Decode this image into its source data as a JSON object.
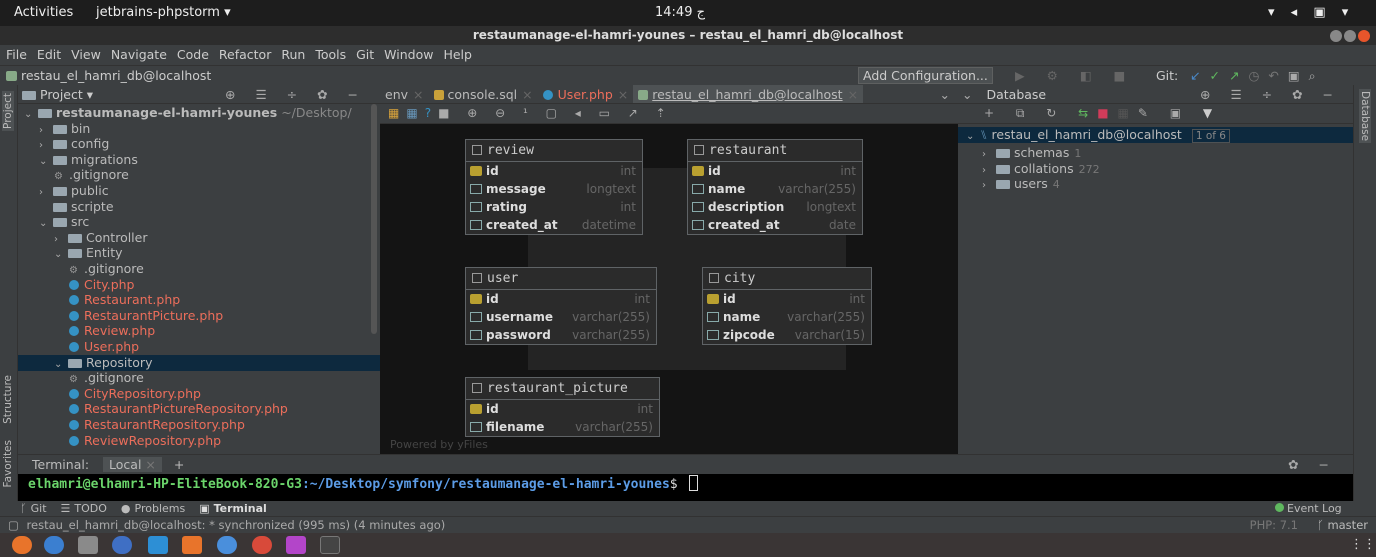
{
  "topbar": {
    "activities": "Activities",
    "app": "jetbrains-phpstorm ▾",
    "clock": "14:49 ج"
  },
  "titlebar": {
    "title": "restaumanage-el-hamri-younes – restau_el_hamri_db@localhost"
  },
  "menu": [
    "File",
    "Edit",
    "View",
    "Navigate",
    "Code",
    "Refactor",
    "Run",
    "Tools",
    "Git",
    "Window",
    "Help"
  ],
  "navbar": {
    "crumb": "restau_el_hamri_db@localhost",
    "add_config": "Add Configuration...",
    "git_label": "Git:"
  },
  "sidebar_left": {
    "project": "Project",
    "structure": "Structure",
    "favorites": "Favorites"
  },
  "sidebar_right": {
    "database": "Database"
  },
  "project_panel": {
    "title": "Project ▾"
  },
  "tree": [
    {
      "label": "restaumanage-el-hamri-younes",
      "suffix": "~/Desktop/",
      "kind": "folder",
      "indent": 0,
      "open": true,
      "bold": true
    },
    {
      "label": "bin",
      "kind": "folder",
      "indent": 1,
      "open": false
    },
    {
      "label": "config",
      "kind": "folder",
      "indent": 1,
      "open": false
    },
    {
      "label": "migrations",
      "kind": "folder",
      "indent": 1,
      "open": true
    },
    {
      "label": ".gitignore",
      "kind": "git",
      "indent": 2
    },
    {
      "label": "public",
      "kind": "folder",
      "indent": 1,
      "open": false
    },
    {
      "label": "scripte",
      "kind": "folder",
      "indent": 1,
      "noarrow": true
    },
    {
      "label": "src",
      "kind": "folder",
      "indent": 1,
      "open": true
    },
    {
      "label": "Controller",
      "kind": "folder",
      "indent": 2,
      "open": false
    },
    {
      "label": "Entity",
      "kind": "folder",
      "indent": 2,
      "open": true
    },
    {
      "label": ".gitignore",
      "kind": "git",
      "indent": 3
    },
    {
      "label": "City.php",
      "kind": "class",
      "indent": 3
    },
    {
      "label": "Restaurant.php",
      "kind": "class",
      "indent": 3
    },
    {
      "label": "RestaurantPicture.php",
      "kind": "class",
      "indent": 3
    },
    {
      "label": "Review.php",
      "kind": "class",
      "indent": 3
    },
    {
      "label": "User.php",
      "kind": "class",
      "indent": 3
    },
    {
      "label": "Repository",
      "kind": "folder",
      "indent": 2,
      "open": true,
      "selected": true
    },
    {
      "label": ".gitignore",
      "kind": "git",
      "indent": 3
    },
    {
      "label": "CityRepository.php",
      "kind": "class",
      "indent": 3
    },
    {
      "label": "RestaurantPictureRepository.php",
      "kind": "class",
      "indent": 3
    },
    {
      "label": "RestaurantRepository.php",
      "kind": "class",
      "indent": 3
    },
    {
      "label": "ReviewRepository.php",
      "kind": "class",
      "indent": 3
    }
  ],
  "tabs": [
    {
      "label": "env",
      "active": false
    },
    {
      "label": "console.sql",
      "active": false
    },
    {
      "label": "User.php",
      "active": false
    },
    {
      "label": "restau_el_hamri_db@localhost",
      "active": true
    }
  ],
  "diagram": {
    "powered": "Powered by yFiles",
    "tables": [
      {
        "id": "review",
        "name": "review",
        "cols": [
          {
            "n": "id",
            "t": "int",
            "pk": true
          },
          {
            "n": "message",
            "t": "longtext"
          },
          {
            "n": "rating",
            "t": "int"
          },
          {
            "n": "created_at",
            "t": "datetime"
          }
        ]
      },
      {
        "id": "restaurant",
        "name": "restaurant",
        "cols": [
          {
            "n": "id",
            "t": "int",
            "pk": true
          },
          {
            "n": "name",
            "t": "varchar(255)"
          },
          {
            "n": "description",
            "t": "longtext"
          },
          {
            "n": "created_at",
            "t": "date"
          }
        ]
      },
      {
        "id": "user",
        "name": "user",
        "cols": [
          {
            "n": "id",
            "t": "int",
            "pk": true
          },
          {
            "n": "username",
            "t": "varchar(255)"
          },
          {
            "n": "password",
            "t": "varchar(255)"
          }
        ]
      },
      {
        "id": "city",
        "name": "city",
        "cols": [
          {
            "n": "id",
            "t": "int",
            "pk": true
          },
          {
            "n": "name",
            "t": "varchar(255)"
          },
          {
            "n": "zipcode",
            "t": "varchar(15)"
          }
        ]
      },
      {
        "id": "restaurant_picture",
        "name": "restaurant_picture",
        "cols": [
          {
            "n": "id",
            "t": "int",
            "pk": true
          },
          {
            "n": "filename",
            "t": "varchar(255)"
          }
        ]
      }
    ]
  },
  "database_panel": {
    "title": "Database",
    "root": "restau_el_hamri_db@localhost",
    "root_badge": "1 of 6",
    "children": [
      {
        "label": "schemas",
        "count": "1"
      },
      {
        "label": "collations",
        "count": "272"
      },
      {
        "label": "users",
        "count": "4"
      }
    ]
  },
  "terminal": {
    "label": "Terminal:",
    "tab": "Local",
    "prompt_user": "elhamri@elhamri-HP-EliteBook-820-G3",
    "prompt_path": ":~/Desktop/symfony/restaumanage-el-hamri-younes",
    "prompt_end": "$"
  },
  "bottom_tabs": [
    "Git",
    "TODO",
    "Problems",
    "Terminal"
  ],
  "event_log": "Event Log",
  "status": {
    "text": "restau_el_hamri_db@localhost: * synchronized (995 ms) (4 minutes ago)",
    "php": "PHP: 7.1",
    "branch": "master"
  },
  "colors": {
    "accent": "#4a88c7",
    "selection": "#0d293e",
    "class_icon": "#3592c4",
    "modified": "#ec6e5b",
    "prompt_user": "#6bd46b",
    "prompt_path": "#5c9ce6"
  }
}
